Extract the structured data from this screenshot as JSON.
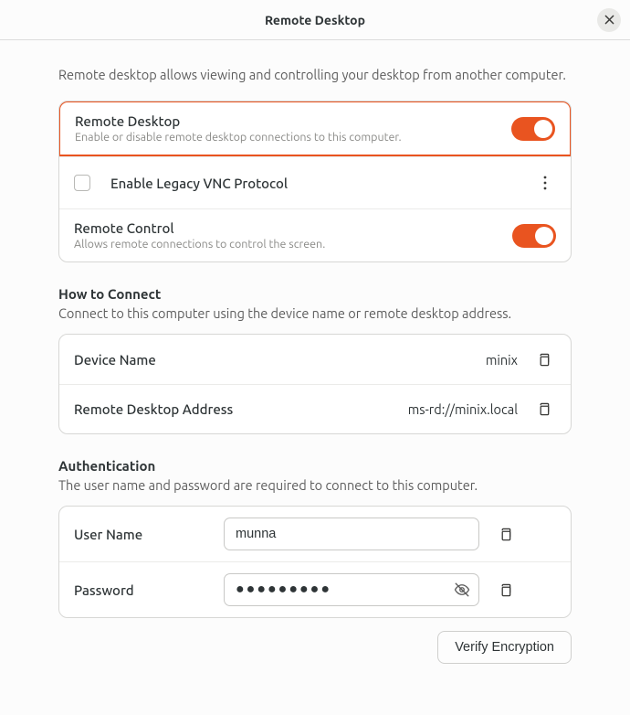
{
  "header": {
    "title": "Remote Desktop"
  },
  "intro": "Remote desktop allows viewing and controlling your desktop from another computer.",
  "main_group": {
    "remote_desktop": {
      "title": "Remote Desktop",
      "subtitle": "Enable or disable remote desktop connections to this computer.",
      "enabled": true
    },
    "legacy_vnc": {
      "label": "Enable Legacy VNC Protocol",
      "checked": false
    },
    "remote_control": {
      "title": "Remote Control",
      "subtitle": "Allows remote connections to control the screen.",
      "enabled": true
    }
  },
  "connect": {
    "section_title": "How to Connect",
    "section_sub": "Connect to this computer using the device name or remote desktop address.",
    "device_name": {
      "label": "Device Name",
      "value": "minix"
    },
    "address": {
      "label": "Remote Desktop Address",
      "value": "ms-rd://minix.local"
    }
  },
  "auth": {
    "section_title": "Authentication",
    "section_sub": "The user name and password are required to connect to this computer.",
    "username": {
      "label": "User Name",
      "value": "munna"
    },
    "password": {
      "label": "Password",
      "masked": "●●●●●●●●●"
    }
  },
  "footer": {
    "verify_label": "Verify Encryption"
  }
}
